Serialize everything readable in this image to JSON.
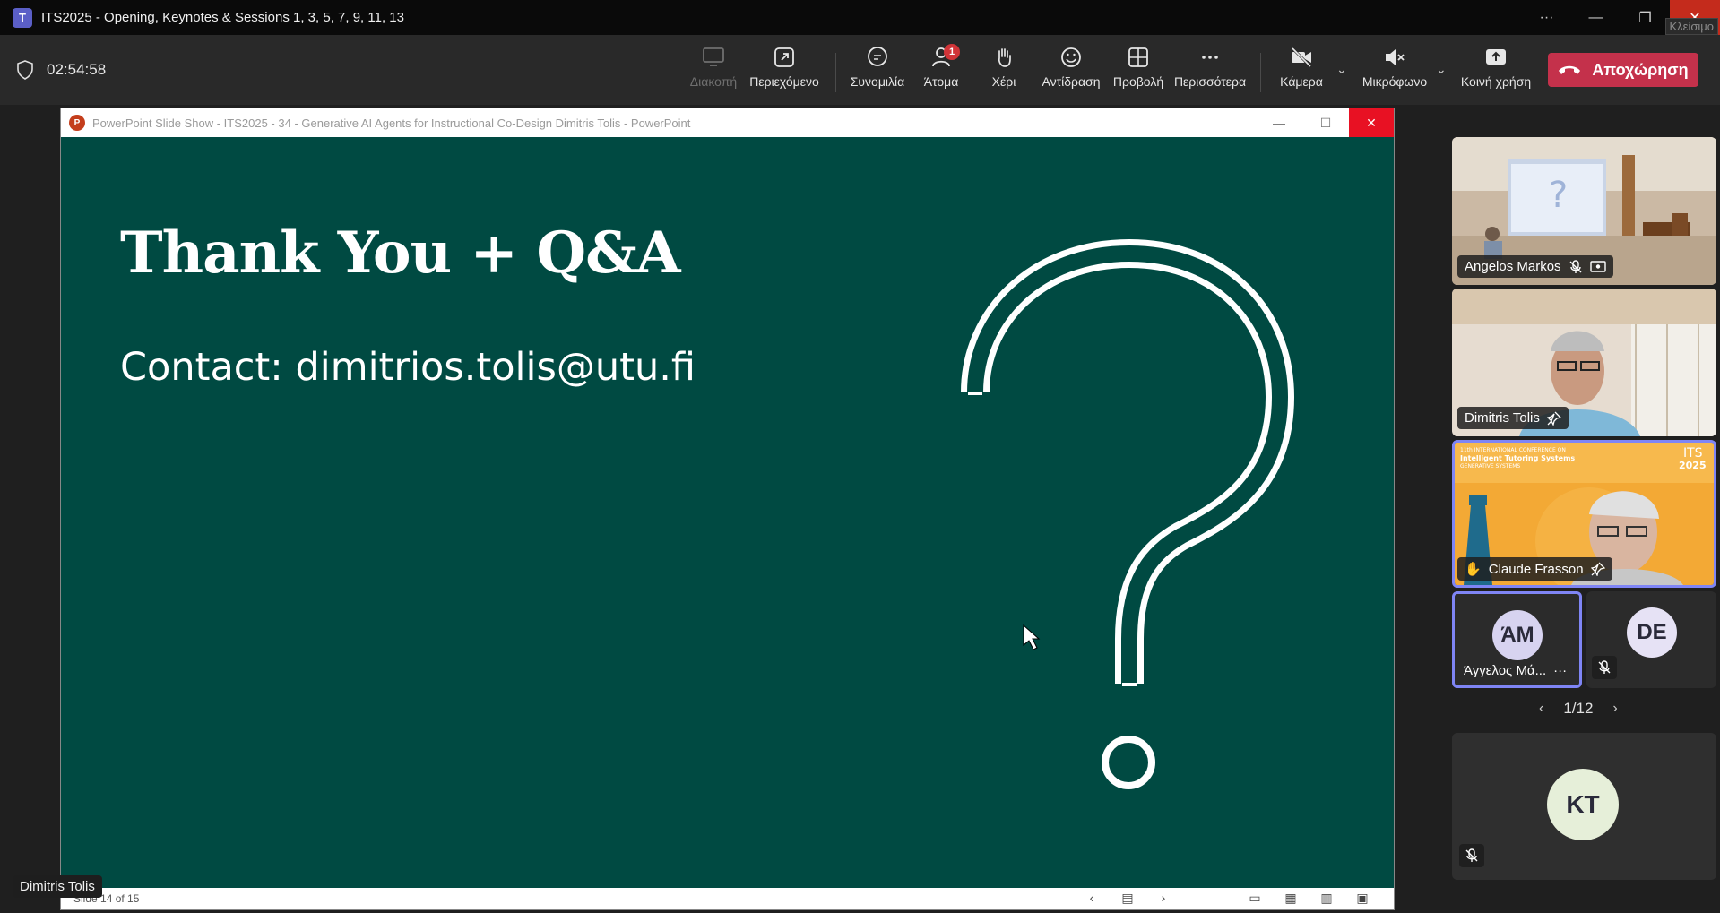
{
  "window": {
    "app_icon": "teams-icon",
    "title": "ITS2025 - Opening, Keynotes & Sessions 1, 3, 5, 7, 9, 11, 13",
    "tooltip_close": "Κλείσιμο"
  },
  "toolbar": {
    "timer": "02:54:58",
    "share_stop": "Διακοπή",
    "content": "Περιεχόμενο",
    "chat": "Συνομιλία",
    "people": "Άτομα",
    "people_badge": "1",
    "raise_hand": "Χέρι",
    "react": "Αντίδραση",
    "view": "Προβολή",
    "more": "Περισσότερα",
    "camera": "Κάμερα",
    "mic": "Μικρόφωνο",
    "share": "Κοινή χρήση",
    "leave": "Αποχώρηση"
  },
  "ppt": {
    "title": "PowerPoint Slide Show  -  ITS2025 - 34 - Generative AI Agents for Instructional Co-Design Dimitris Tolis - PowerPoint",
    "slide_title": "Thank You + Q&A",
    "slide_contact": "Contact: dimitrios.tolis@utu.fi",
    "slide_counter": "Slide 14 of 15",
    "colors": {
      "slide_bg": "#004a42"
    }
  },
  "presenter_label": "Dimitris Tolis",
  "participants": {
    "tiles": [
      {
        "name": "Angelos Markos"
      },
      {
        "name": "Dimitris Tolis"
      },
      {
        "name": "Claude Frasson",
        "slide_org": "11th INTERNATIONAL CONFERENCE ON",
        "slide_conf": "Intelligent Tutoring Systems",
        "slide_sub": "GENERATIVE SYSTEMS",
        "slide_its": "ITS",
        "slide_year": "2025"
      },
      {
        "name": "Άγγελος Μά...",
        "initials": "ΆΜ"
      },
      {
        "initials": "DE"
      },
      {
        "initials": "KT"
      }
    ],
    "pager": "1/12"
  }
}
